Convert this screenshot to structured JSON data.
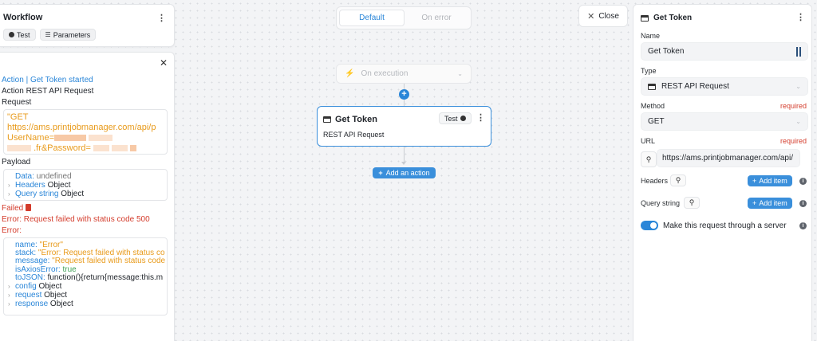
{
  "workflow": {
    "title": "Workflow",
    "test_label": "Test",
    "parameters_label": "Parameters"
  },
  "log": {
    "started": "Action | Get Token started",
    "action_type": "Action REST API Request",
    "request_label": "Request",
    "request_lines": [
      "\"GET",
      "https://ams.printjobmanager.com/api/p",
      "UserName=",
      ".fr&Password="
    ],
    "payload_label": "Payload",
    "payload": {
      "data_key": "Data:",
      "data_val": "undefined",
      "headers_key": "Headers",
      "headers_val": "Object",
      "query_key": "Query string",
      "query_val": "Object"
    },
    "failed_label": "Failed",
    "error_msg": "Error: Request failed with status code 500",
    "error_label": "Error:",
    "error_fields": {
      "name_key": "name:",
      "name_val": "\"Error\"",
      "stack_key": "stack:",
      "stack_val": "\"Error: Request failed with status co",
      "message_key": "message:",
      "message_val": "\"Request failed with status code",
      "axios_key": "isAxiosError:",
      "axios_val": "true",
      "tojson_key": "toJSON:",
      "tojson_val": "function(){return{message:this.m",
      "config_key": "config",
      "config_val": "Object",
      "request_key": "request",
      "request_val": "Object",
      "response_key": "response",
      "response_val": "Object"
    }
  },
  "canvas": {
    "tab_default": "Default",
    "tab_error": "On error",
    "trigger_label": "On execution",
    "node_title": "Get Token",
    "node_subtitle": "REST API Request",
    "node_test": "Test",
    "add_action": "Add an action"
  },
  "close_label": "Close",
  "panel": {
    "title": "Get Token",
    "name_label": "Name",
    "name_value": "Get Token",
    "type_label": "Type",
    "type_value": "REST API Request",
    "method_label": "Method",
    "method_value": "GET",
    "url_label": "URL",
    "url_value": "https://ams.printjobmanager.com/api/",
    "required": "required",
    "headers_label": "Headers",
    "query_label": "Query string",
    "add_item": "Add item",
    "server_toggle_label": "Make this request through a server",
    "server_toggle_on": true
  },
  "colors": {
    "accent": "#2a86d8",
    "error": "#d43c2c",
    "string": "#e89a1a"
  }
}
